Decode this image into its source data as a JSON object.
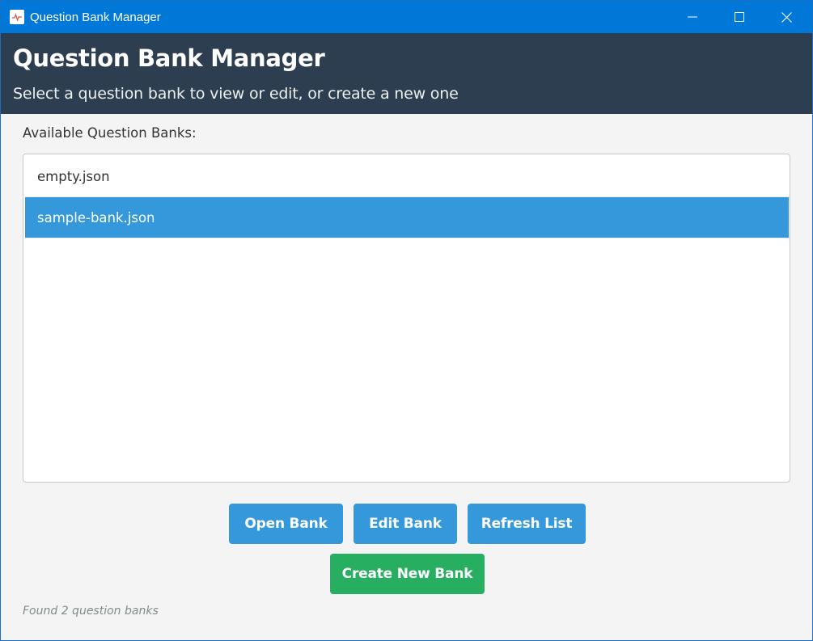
{
  "window": {
    "title": "Question Bank Manager",
    "controls": {
      "minimize_icon": "minimize-icon",
      "maximize_icon": "maximize-icon",
      "close_icon": "close-icon"
    },
    "accent_color": "#0078d7"
  },
  "header": {
    "title": "Question Bank Manager",
    "subtitle": "Select a question bank to view or edit, or create a new one",
    "background_color": "#2c3e50"
  },
  "list": {
    "label": "Available Question Banks:",
    "items": [
      {
        "label": "empty.json",
        "selected": false
      },
      {
        "label": "sample-bank.json",
        "selected": true
      }
    ],
    "selection_color": "#3498db"
  },
  "actions": {
    "open_label": "Open Bank",
    "edit_label": "Edit Bank",
    "refresh_label": "Refresh List",
    "create_label": "Create New Bank",
    "primary_color": "#3498db",
    "create_color": "#27ae60"
  },
  "status": {
    "text": "Found 2 question banks"
  }
}
